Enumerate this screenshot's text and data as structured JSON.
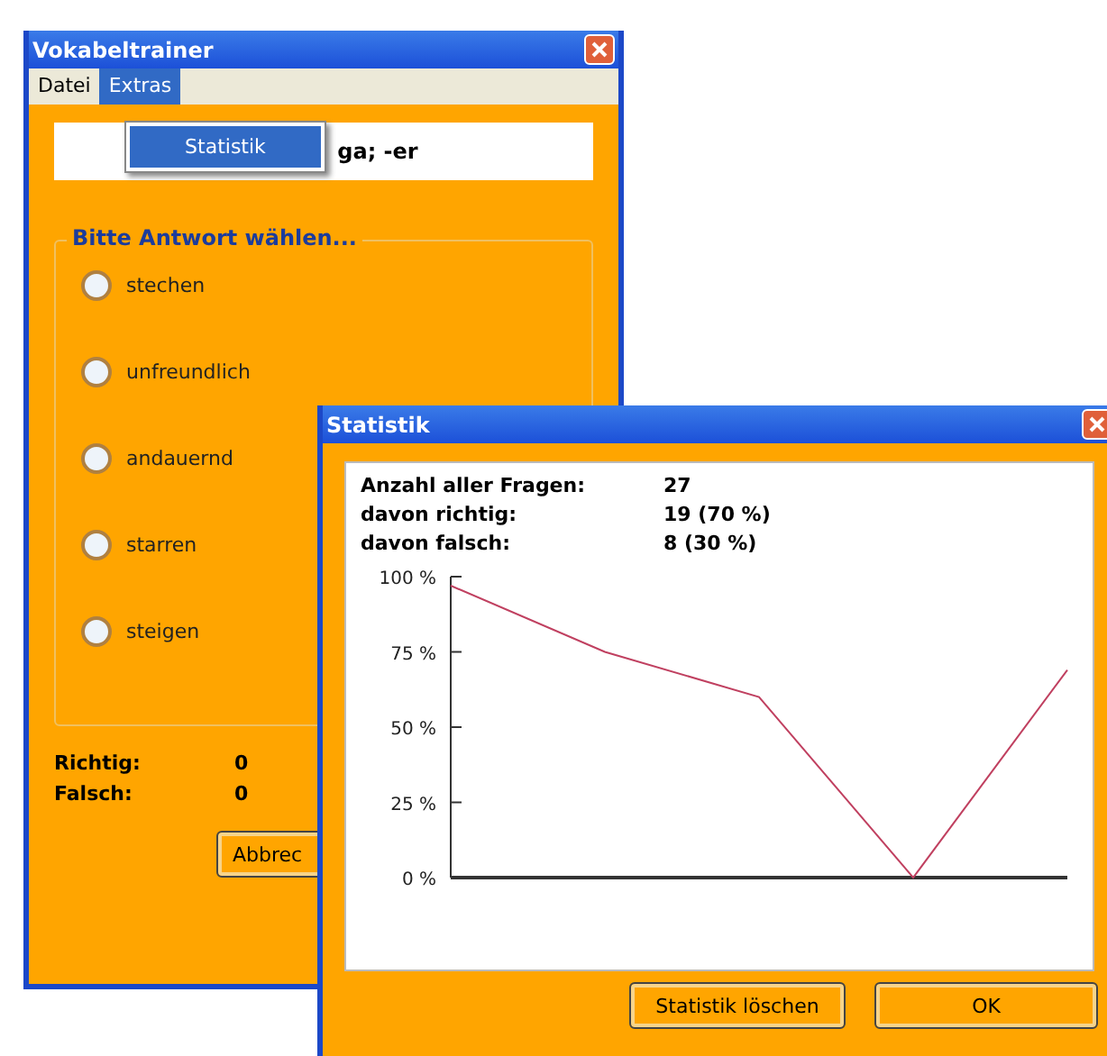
{
  "main_window": {
    "title": "Vokabeltrainer",
    "menu": [
      {
        "label": "Datei",
        "selected": false
      },
      {
        "label": "Extras",
        "selected": true
      }
    ],
    "open_menu": {
      "items": [
        {
          "label": "Statistik",
          "selected": true
        }
      ]
    },
    "word": "ga; -er",
    "group": {
      "title": "Bitte Antwort wählen...",
      "options": [
        {
          "label": "stechen",
          "checked": false
        },
        {
          "label": "unfreundlich",
          "checked": false
        },
        {
          "label": "andauernd",
          "checked": false
        },
        {
          "label": "starren",
          "checked": false
        },
        {
          "label": "steigen",
          "checked": false
        }
      ]
    },
    "score": [
      {
        "label": "Richtig:",
        "value": "0"
      },
      {
        "label": "Falsch:",
        "value": "0"
      }
    ],
    "button": "Abbrec"
  },
  "stats_window": {
    "title": "Statistik",
    "rows": [
      {
        "label": "Anzahl aller Fragen:",
        "value": "27"
      },
      {
        "label": "davon richtig:",
        "value": "19 (70 %)"
      },
      {
        "label": "davon falsch:",
        "value": "8 (30 %)"
      }
    ],
    "chart_data": {
      "type": "line",
      "series": [
        {
          "color": "#c04060",
          "values": [
            97,
            75,
            60,
            0,
            69
          ]
        }
      ],
      "ylim": [
        0,
        100
      ],
      "yticks": [
        {
          "value": 100,
          "label": "100 %"
        },
        {
          "value": 75,
          "label": "75 %"
        },
        {
          "value": 50,
          "label": "50 %"
        },
        {
          "value": 25,
          "label": "25 %"
        },
        {
          "value": 0,
          "label": "0 %"
        }
      ]
    },
    "buttons": [
      "Statistik löschen",
      "OK"
    ]
  }
}
